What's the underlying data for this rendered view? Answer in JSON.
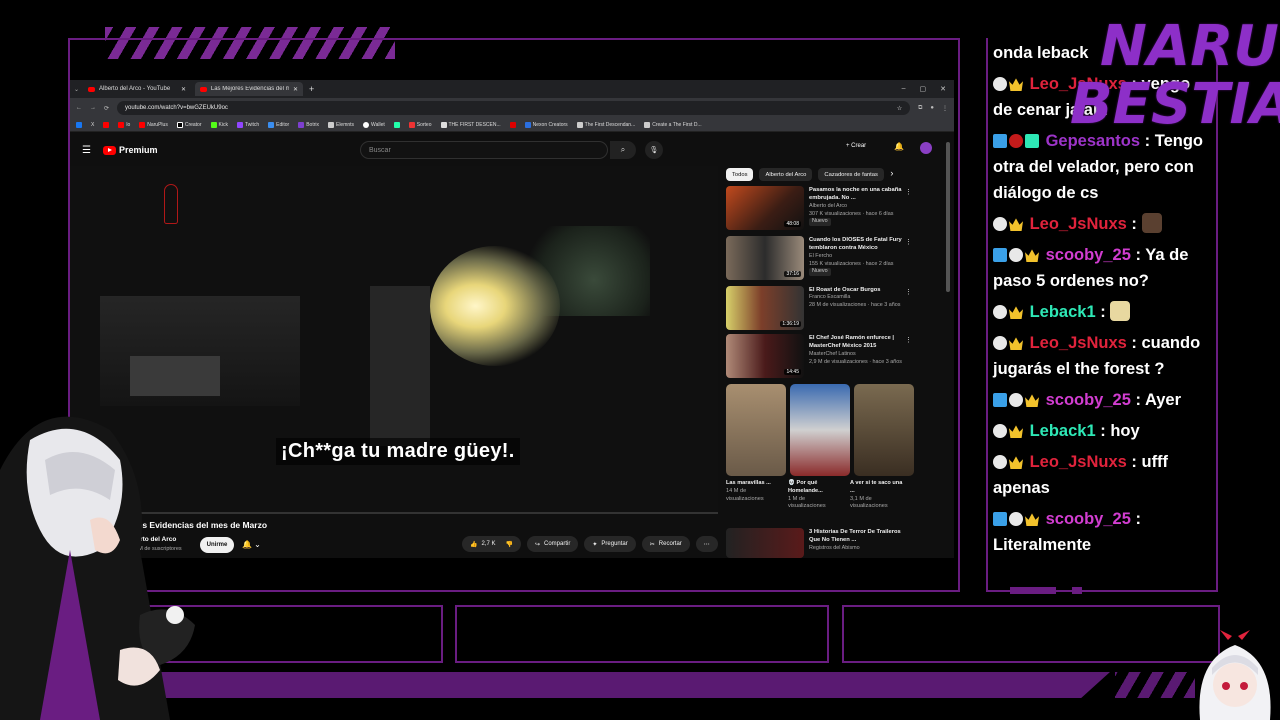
{
  "browser": {
    "tabs": [
      {
        "label": "Alberto del Arco - YouTube",
        "active": false
      },
      {
        "label": "Las Mejores Evidencias del mes",
        "active": true
      }
    ],
    "url": "youtube.com/watch?v=bwGZEUkU9oc",
    "bookmarks": [
      "",
      "X",
      "",
      "",
      "NaruPlus",
      "Creator",
      "Kick",
      "Twitch",
      "Editor",
      "Botrix",
      "Elemnts",
      "Wallet",
      "",
      "Sorteo",
      "THE FIRST DESCEN...",
      "",
      "Nexon Creators",
      "The First Descendan...",
      "Create a The First D..."
    ],
    "window_controls": [
      "–",
      "▢",
      "✕"
    ]
  },
  "youtube": {
    "logo": "Premium",
    "search_placeholder": "Buscar",
    "crear_label": "Crear",
    "video": {
      "subtitle": "¡Ch**ga tu madre güey!.",
      "title": "ejores Evidencias del mes de Marzo",
      "channel": "Alberto del Arco",
      "subscribers": "3,97 M de suscriptores",
      "subscribe_label": "Unirme",
      "likes": "2,7 K",
      "share_label": "Compartir",
      "ask_label": "Preguntar",
      "clip_label": "Recortar"
    },
    "chips": [
      "Todos",
      "Alberto del Arco",
      "Cazadores de fantas"
    ],
    "recommended": [
      {
        "title": "Pasamos la noche en una cabaña embrujada. No ...",
        "channel": "Alberto del Arco",
        "meta": "307 K visualizaciones · hace 6 días",
        "badge": "Nuevo",
        "duration": "48:08"
      },
      {
        "title": "Cuando los DIOSES de Fatal Fury temblaron contra México",
        "channel": "El Fercho",
        "meta": "155 K visualizaciones · hace 2 días",
        "badge": "Nuevo",
        "duration": "37:16"
      },
      {
        "title": "El Roast de Oscar Burgos",
        "channel": "Franco Escamilla",
        "meta": "28 M de visualizaciones · hace 3 años",
        "badge": "",
        "duration": "1:36:19"
      },
      {
        "title": "El Chef José Ramón enfurece | MasterChef México 2015",
        "channel": "MasterChef Latinos",
        "meta": "2,9 M de visualizaciones · hace 3 años",
        "badge": "",
        "duration": "14:45"
      }
    ],
    "shorts": [
      {
        "title": "Las maravillas ...",
        "views": "14 M de visualizaciones"
      },
      {
        "title": "💀 Por qué Homelande...",
        "views": "1 M de visualizaciones"
      },
      {
        "title": "A ver si te saco una ...",
        "views": "3,1 M de visualizaciones"
      }
    ],
    "last_rec": {
      "title": "3 Historias De Terror De Traileros Que No Tienen ...",
      "channel": "Registros del Abismo"
    }
  },
  "chat": {
    "messages": [
      {
        "user": "",
        "text": "onda leback"
      },
      {
        "user": "Leo_JsNuxs",
        "text": ": vengo de cenar jajaja"
      },
      {
        "user": "Gepesantos",
        "text": ": Tengo otra del velador, pero con diálogo de cs"
      },
      {
        "user": "Leo_JsNuxs",
        "text": ":"
      },
      {
        "user": "scooby_25",
        "text": ": Ya de paso 5 ordenes no?"
      },
      {
        "user": "Leback1",
        "text": ":"
      },
      {
        "user": "Leo_JsNuxs",
        "text": ": cuando jugarás el the forest ?"
      },
      {
        "user": "scooby_25",
        "text": ": Ayer"
      },
      {
        "user": "Leback1",
        "text": ": hoy"
      },
      {
        "user": "Leo_JsNuxs",
        "text": ": ufff apenas"
      },
      {
        "user": "scooby_25",
        "text": ": Literalmente"
      }
    ]
  },
  "branding": {
    "line1": "NARU",
    "line2": "BESTIA"
  },
  "colors": {
    "accent": "#6a1d82",
    "yt_red": "#ff0000",
    "chat_red": "#e0233c",
    "chat_pink": "#d13dd0",
    "chat_teal": "#2ee8b6"
  }
}
